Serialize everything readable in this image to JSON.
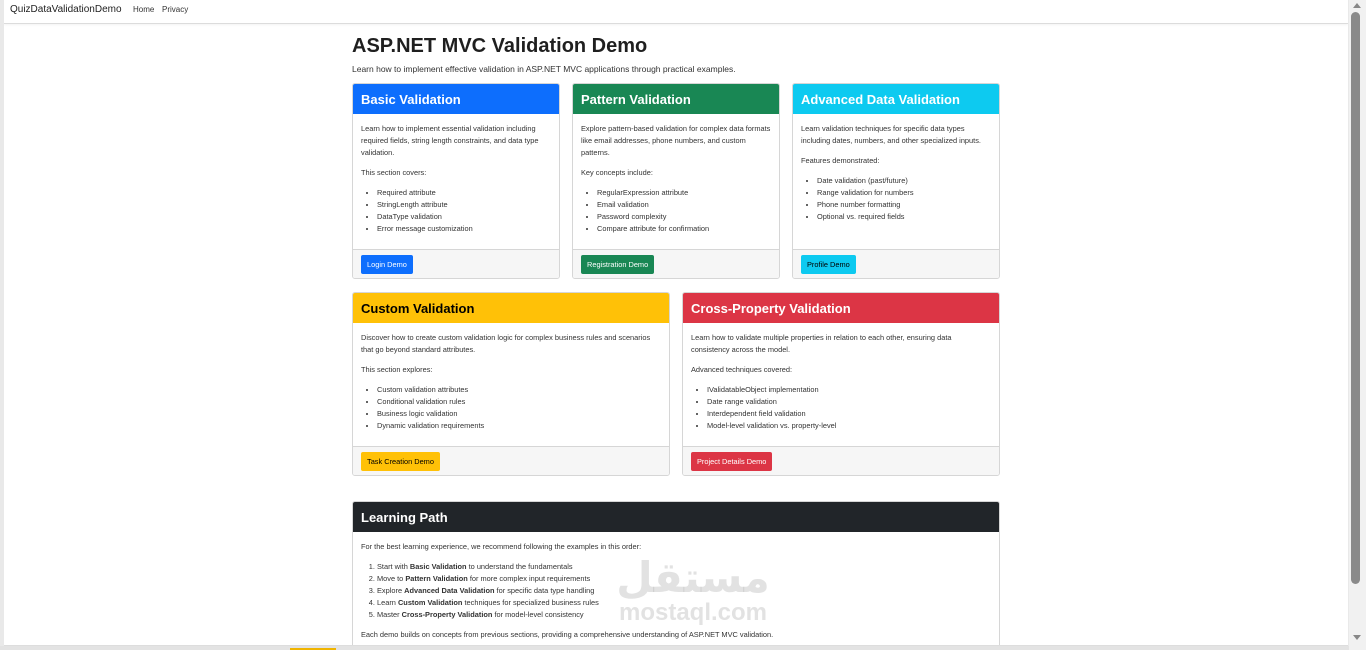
{
  "navbar": {
    "brand": "QuizDataValidationDemo",
    "links": [
      "Home",
      "Privacy"
    ]
  },
  "header": {
    "title": "ASP.NET MVC Validation Demo",
    "lead": "Learn how to implement effective validation in ASP.NET MVC applications through practical examples."
  },
  "cards": [
    {
      "title": "Basic Validation",
      "desc": "Learn how to implement essential validation including required fields, string length constraints, and data type validation.",
      "sub": "This section covers:",
      "items": [
        "Required attribute",
        "StringLength attribute",
        "DataType validation",
        "Error message customization"
      ],
      "button": "Login Demo",
      "color": "#0d6efd"
    },
    {
      "title": "Pattern Validation",
      "desc": "Explore pattern-based validation for complex data formats like email addresses, phone numbers, and custom patterns.",
      "sub": "Key concepts include:",
      "items": [
        "RegularExpression attribute",
        "Email validation",
        "Password complexity",
        "Compare attribute for confirmation"
      ],
      "button": "Registration Demo",
      "color": "#198754"
    },
    {
      "title": "Advanced Data Validation",
      "desc": "Learn validation techniques for specific data types including dates, numbers, and other specialized inputs.",
      "sub": "Features demonstrated:",
      "items": [
        "Date validation (past/future)",
        "Range validation for numbers",
        "Phone number formatting",
        "Optional vs. required fields"
      ],
      "button": "Profile Demo",
      "color": "#0dcaf0"
    },
    {
      "title": "Custom Validation",
      "desc": "Discover how to create custom validation logic for complex business rules and scenarios that go beyond standard attributes.",
      "sub": "This section explores:",
      "items": [
        "Custom validation attributes",
        "Conditional validation rules",
        "Business logic validation",
        "Dynamic validation requirements"
      ],
      "button": "Task Creation Demo",
      "color": "#ffc107"
    },
    {
      "title": "Cross-Property Validation",
      "desc": "Learn how to validate multiple properties in relation to each other, ensuring data consistency across the model.",
      "sub": "Advanced techniques covered:",
      "items": [
        "IValidatableObject implementation",
        "Date range validation",
        "Interdependent field validation",
        "Model-level validation vs. property-level"
      ],
      "button": "Project Details Demo",
      "color": "#dc3545"
    }
  ],
  "learning": {
    "title": "Learning Path",
    "intro": "For the best learning experience, we recommend following the examples in this order:",
    "steps": [
      {
        "pre": "Start with ",
        "bold": "Basic Validation",
        "post": " to understand the fundamentals"
      },
      {
        "pre": "Move to ",
        "bold": "Pattern Validation",
        "post": " for more complex input requirements"
      },
      {
        "pre": "Explore ",
        "bold": "Advanced Data Validation",
        "post": " for specific data type handling"
      },
      {
        "pre": "Learn ",
        "bold": "Custom Validation",
        "post": " techniques for specialized business rules"
      },
      {
        "pre": "Master ",
        "bold": "Cross-Property Validation",
        "post": " for model-level consistency"
      }
    ],
    "outro": "Each demo builds on concepts from previous sections, providing a comprehensive understanding of ASP.NET MVC validation."
  },
  "watermark": {
    "arabic": "مستقل",
    "latin": "mostaql.com"
  }
}
